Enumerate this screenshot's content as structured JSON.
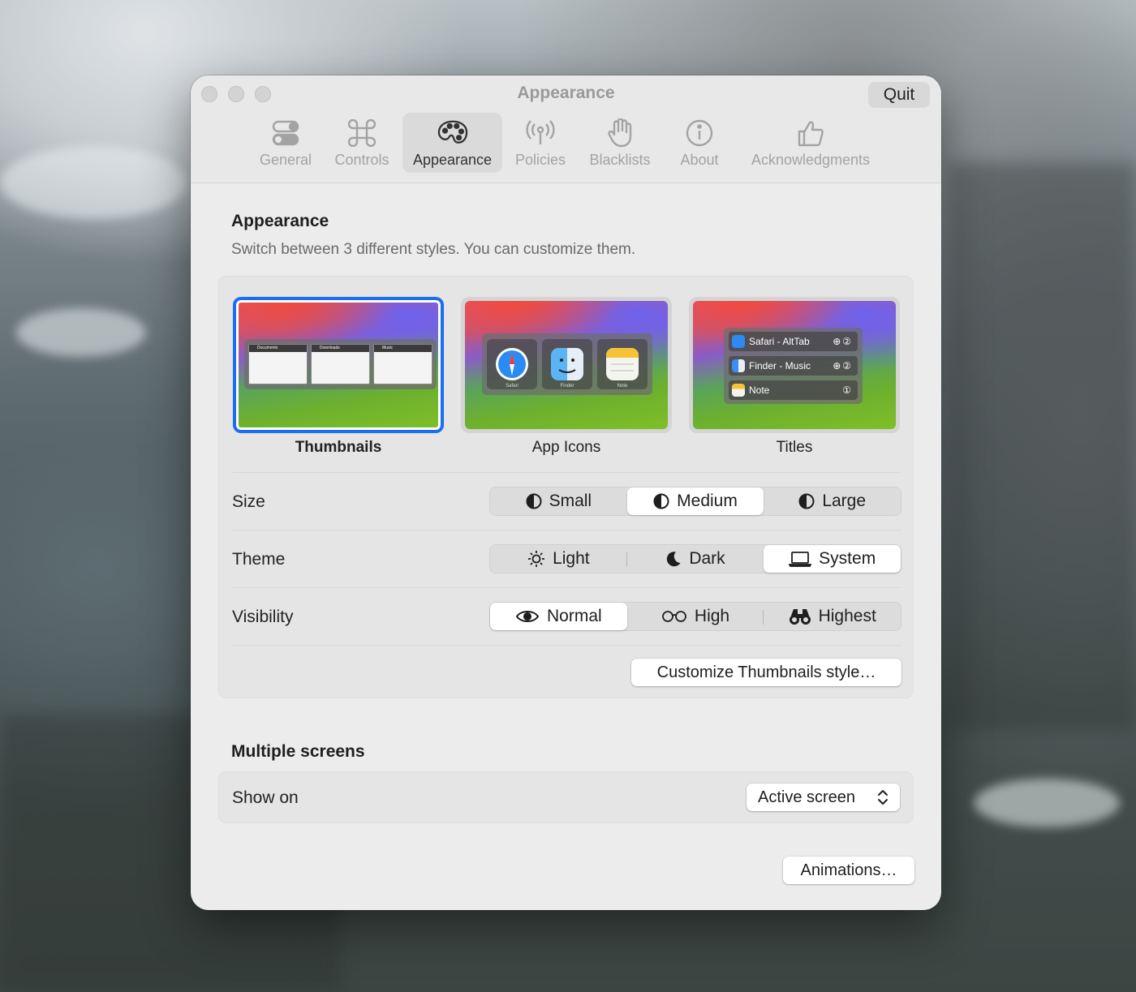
{
  "window": {
    "title": "Appearance",
    "quit_label": "Quit"
  },
  "toolbar": {
    "tabs": [
      {
        "label": "General",
        "icon": "toggles-icon"
      },
      {
        "label": "Controls",
        "icon": "command-icon"
      },
      {
        "label": "Appearance",
        "icon": "palette-icon",
        "selected": true
      },
      {
        "label": "Policies",
        "icon": "antenna-icon"
      },
      {
        "label": "Blacklists",
        "icon": "hand-icon"
      },
      {
        "label": "About",
        "icon": "info-icon"
      },
      {
        "label": "Acknowledgments",
        "icon": "thumbs-up-icon"
      }
    ]
  },
  "appearance": {
    "title": "Appearance",
    "subtitle": "Switch between 3 different styles. You can customize them.",
    "styles": [
      {
        "label": "Thumbnails",
        "selected": true,
        "preview_windows": [
          "Documents",
          "Downloads",
          "Music"
        ]
      },
      {
        "label": "App Icons",
        "selected": false,
        "preview_apps": [
          "Safari",
          "Finder",
          "Note"
        ]
      },
      {
        "label": "Titles",
        "selected": false,
        "preview_rows": [
          {
            "app": "Safari - AltTab",
            "meta": "⊕②"
          },
          {
            "app": "Finder - Music",
            "meta": "⊕②"
          },
          {
            "app": "Note",
            "meta": "①"
          }
        ]
      }
    ],
    "size": {
      "label": "Size",
      "options": [
        "Small",
        "Medium",
        "Large"
      ],
      "selected": "Medium"
    },
    "theme": {
      "label": "Theme",
      "options": [
        "Light",
        "Dark",
        "System"
      ],
      "selected": "System"
    },
    "visibility": {
      "label": "Visibility",
      "options": [
        "Normal",
        "High",
        "Highest"
      ],
      "selected": "Normal"
    },
    "customize_button": "Customize Thumbnails style…"
  },
  "multiple_screens": {
    "title": "Multiple screens",
    "show_on_label": "Show on",
    "show_on_value": "Active screen"
  },
  "animations_button": "Animations…",
  "colors": {
    "accent": "#1a6ef5",
    "window_bg": "#ececec",
    "group_bg": "#e5e5e5"
  }
}
